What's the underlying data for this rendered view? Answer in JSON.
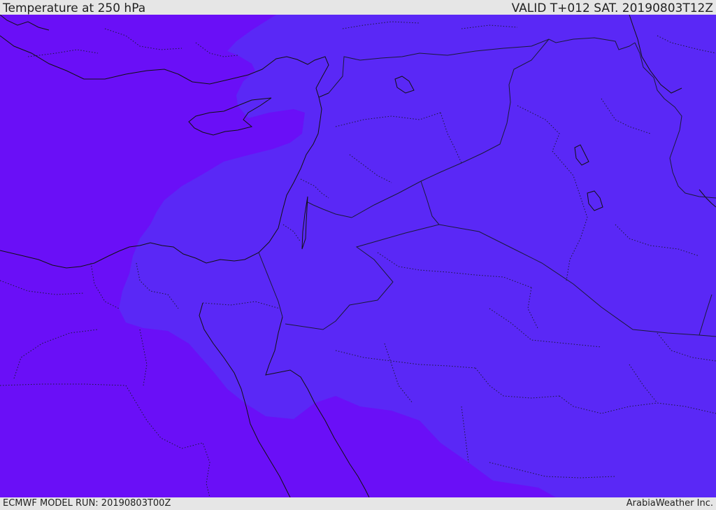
{
  "header": {
    "title": "Temperature at 250 hPa",
    "valid_time": "VALID T+012 SAT. 20190803T12Z"
  },
  "footer": {
    "model_run": "ECMWF MODEL RUN: 20190803T00Z",
    "credit": "ArabiaWeather Inc."
  },
  "map": {
    "colors": {
      "cold_zone": "#6a0ff7",
      "warm_zone": "#5a28f6",
      "coastline": "#111111",
      "border": "#1a1a3a"
    }
  }
}
